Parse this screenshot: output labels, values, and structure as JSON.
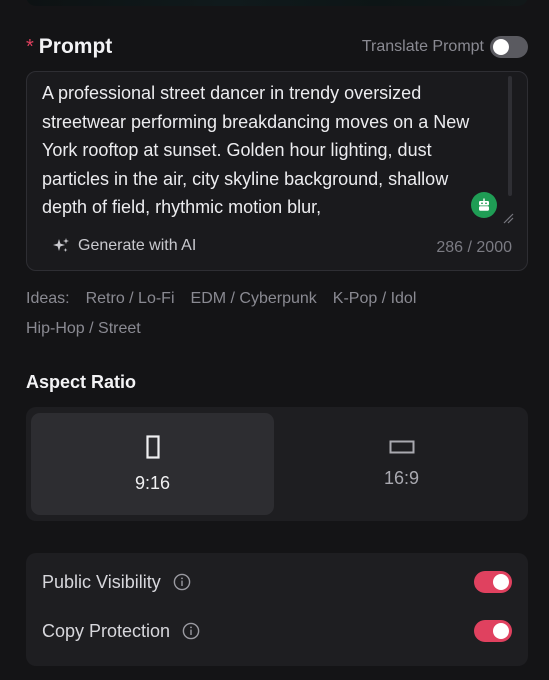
{
  "prompt": {
    "required_marker": "*",
    "title": "Prompt",
    "translate_label": "Translate Prompt",
    "translate_enabled": false,
    "text": "A professional street dancer in trendy oversized streetwear performing breakdancing moves on a New York rooftop at sunset. Golden hour lighting, dust particles in the air, city skyline background, shallow depth of field, rhythmic motion blur,",
    "generate_label": "Generate with AI",
    "char_count": "286 / 2000"
  },
  "ideas": {
    "label": "Ideas:",
    "items": [
      "Retro / Lo-Fi",
      "EDM / Cyberpunk",
      "K-Pop / Idol",
      "Hip-Hop / Street"
    ]
  },
  "aspect_ratio": {
    "title": "Aspect Ratio",
    "options": [
      {
        "label": "9:16",
        "icon": "portrait-rect-icon",
        "selected": true
      },
      {
        "label": "16:9",
        "icon": "landscape-rect-icon",
        "selected": false
      }
    ]
  },
  "settings": {
    "public_visibility": {
      "label": "Public Visibility",
      "enabled": true
    },
    "copy_protection": {
      "label": "Copy Protection",
      "enabled": true
    }
  },
  "colors": {
    "accent": "#e0415f",
    "bot_green": "#1f9d55",
    "background": "#141416",
    "panel": "#1e1e21"
  }
}
